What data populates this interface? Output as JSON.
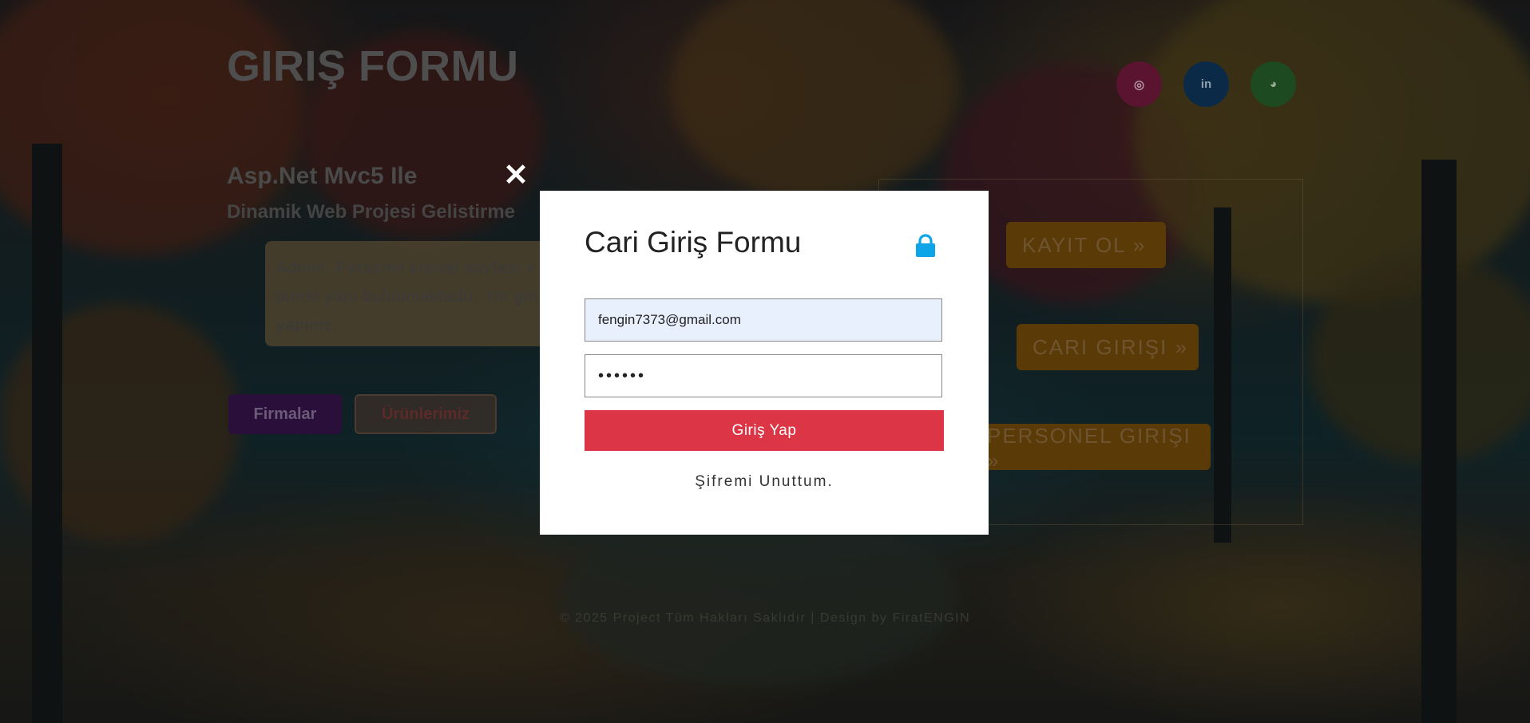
{
  "page": {
    "title": "GIRIŞ FORMU",
    "subtitle1": "Asp.Net Mvc5 Ile",
    "subtitle2": "Dinamik Web Projesi Gelistirme",
    "info_text": "Admin, Personel kişisel sayfası v 3 temel yapı bulunmaktadır. Yet giriş yapınız.",
    "buttons": {
      "firmalar": "Firmalar",
      "urunler": "Ürünlerimiz"
    },
    "side_buttons": {
      "kayit": "KAYIT OL »",
      "cari": "CARI GIRIŞI »",
      "personel": "PERSONEL GIRIŞI »"
    },
    "socials": [
      {
        "icon": "instagram-icon",
        "glyph": "◎"
      },
      {
        "icon": "linkedin-icon",
        "glyph": "in"
      },
      {
        "icon": "globe-icon",
        "glyph": "◕"
      }
    ],
    "footer": "© 2025 Project Tüm Hakları Saklıdır | Design by FiratENGIN"
  },
  "modal": {
    "close_glyph": "✕",
    "title": "Cari Giriş Formu",
    "email_value": "fengin7373@gmail.com",
    "password_value": "••••••",
    "submit_label": "Giriş Yap",
    "forgot_label": "Şifremi Unuttum.",
    "colors": {
      "submit": "#dc3545",
      "lock": "#0da5e8",
      "email_bg": "#e8f0fe"
    }
  }
}
